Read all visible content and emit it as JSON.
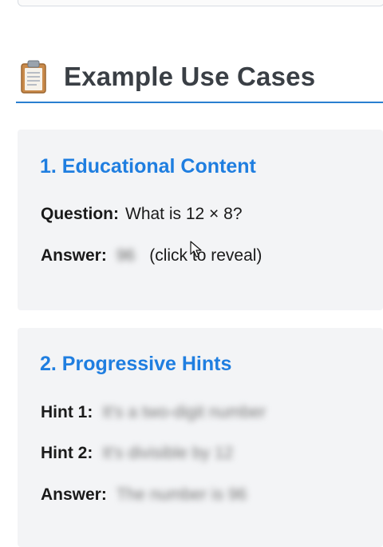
{
  "section": {
    "title": "Example Use Cases",
    "icon": "clipboard-icon"
  },
  "cards": [
    {
      "title": "1. Educational Content",
      "rows": [
        {
          "label": "Question:",
          "value": "What is 12 × 8?"
        },
        {
          "label": "Answer:",
          "hidden_value": "96",
          "note": "(click to reveal)"
        }
      ]
    },
    {
      "title": "2. Progressive Hints",
      "rows": [
        {
          "label": "Hint 1:",
          "hidden_value": "It's a two-digit number"
        },
        {
          "label": "Hint 2:",
          "hidden_value": "It's divisible by 12"
        },
        {
          "label": "Answer:",
          "hidden_value": "The number is 96"
        }
      ]
    }
  ],
  "colors": {
    "accent": "#1f7ee0",
    "rule": "#2a7fd0",
    "card_bg": "#f3f4f6",
    "title": "#3a3f45"
  }
}
